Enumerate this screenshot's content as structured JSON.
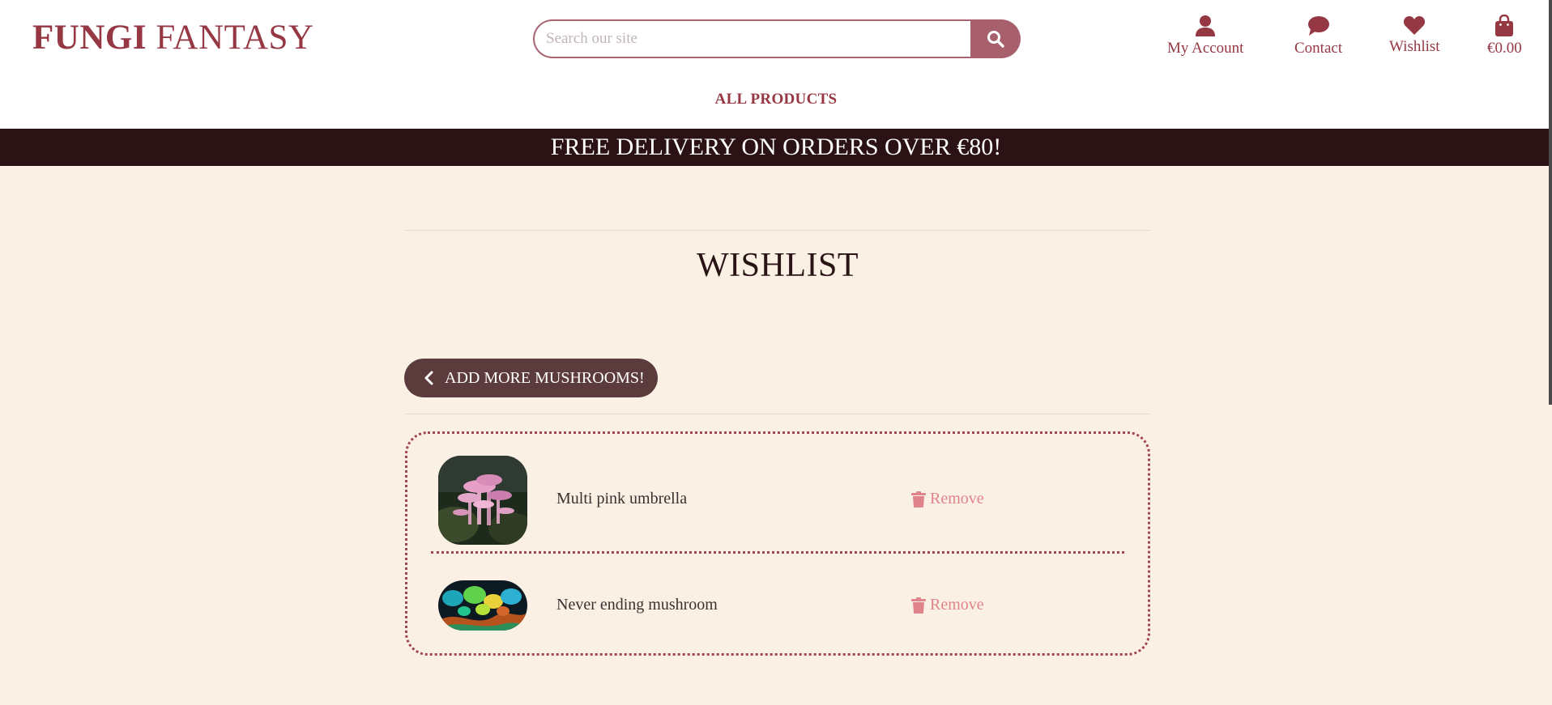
{
  "header": {
    "logo_bold": "FUNGI",
    "logo_rest": "FANTASY",
    "search": {
      "placeholder": "Search our site"
    },
    "nav": {
      "account_label": "My Account",
      "contact_label": "Contact",
      "wishlist_label": "Wishlist",
      "cart_total": "€0.00"
    },
    "menu": {
      "all_products": "ALL PRODUCTS"
    }
  },
  "banner": {
    "text": "FREE DELIVERY ON ORDERS OVER €80!"
  },
  "main": {
    "title": "WISHLIST",
    "back_button_label": "ADD MORE MUSHROOMS!",
    "items": [
      {
        "name": "Multi pink umbrella",
        "remove_label": "Remove"
      },
      {
        "name": "Never ending mushroom",
        "remove_label": "Remove"
      }
    ]
  },
  "colors": {
    "brand": "#963844",
    "banner_bg": "#2b1315",
    "page_bg": "#fbf0e4",
    "button_bg": "#5c3b3c",
    "remove": "#e0848c",
    "search_button": "#a8606d"
  },
  "icons": [
    "search-icon",
    "user-icon",
    "chat-icon",
    "heart-icon",
    "shopping-bag-icon",
    "chevron-left-icon",
    "trash-icon"
  ]
}
